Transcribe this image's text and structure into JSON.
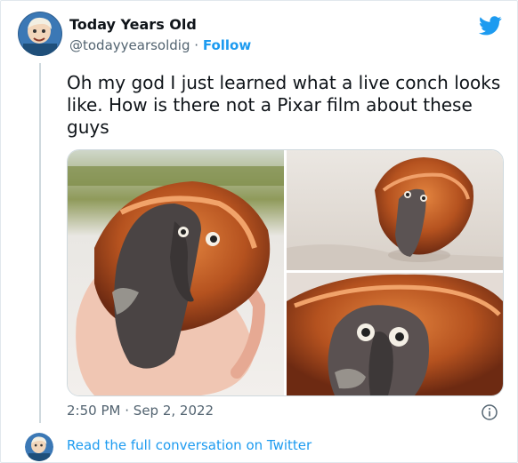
{
  "tweet": {
    "author": {
      "name": "Today Years Old",
      "handle": "@todayyearsoldig",
      "separator": "·",
      "follow_label": "Follow"
    },
    "text": "Oh my god I just learned what a live conch looks like. How is there not a Pixar film about these guys",
    "time": "2:50 PM",
    "date": "Sep 2, 2022",
    "meta_separator": "·",
    "read_more_label": "Read the full conversation on Twitter"
  },
  "icons": {
    "brand": "twitter-bird-icon",
    "info": "info-icon"
  },
  "media": {
    "count": 3,
    "subjects": [
      "conch held in hand",
      "conch on sand",
      "conch close-up"
    ]
  },
  "colors": {
    "accent": "#1d9bf0",
    "text": "#0f1419",
    "secondary_text": "#536471",
    "border": "#cfd9de"
  }
}
